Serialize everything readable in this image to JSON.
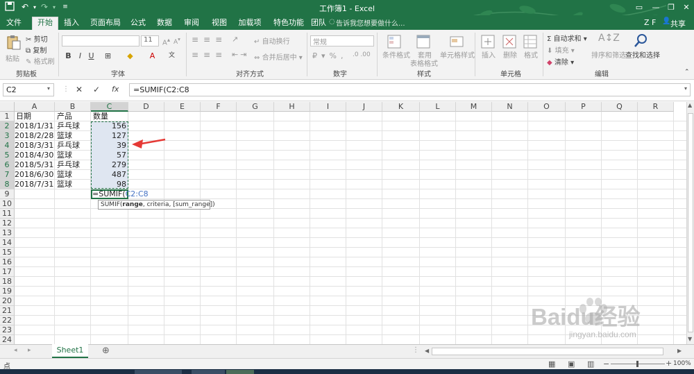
{
  "window": {
    "title": "工作簿1 - Excel",
    "user": "Z F",
    "share": "共享"
  },
  "tabs": [
    "文件",
    "开始",
    "插入",
    "页面布局",
    "公式",
    "数据",
    "审阅",
    "视图",
    "加载项",
    "特色功能",
    "团队"
  ],
  "active_tab": "开始",
  "tell_me": "告诉我您想要做什么...",
  "ribbon": {
    "clipboard": {
      "paste": "粘贴",
      "cut": "剪切",
      "copy": "复制",
      "format_painter": "格式刷",
      "group": "剪贴板"
    },
    "font": {
      "size": "11",
      "group": "字体"
    },
    "alignment": {
      "wrap": "自动换行",
      "merge": "合并后居中",
      "group": "对齐方式"
    },
    "number": {
      "format": "常规",
      "group": "数字"
    },
    "styles": {
      "conditional": "条件格式",
      "table_line1": "套用",
      "table_line2": "表格格式",
      "cell_styles": "单元格样式",
      "group": "样式"
    },
    "cells": {
      "insert": "插入",
      "delete": "删除",
      "format": "格式",
      "group": "单元格"
    },
    "editing": {
      "autosum": "自动求和",
      "fill": "填充",
      "clear": "清除",
      "sort": "排序和筛选",
      "find": "查找和选择",
      "group": "编辑"
    }
  },
  "formula_bar": {
    "name_box": "C2",
    "formula": "=SUMIF(C2:C8",
    "fx": "fx"
  },
  "columns": [
    "A",
    "B",
    "C",
    "D",
    "E",
    "F",
    "G",
    "H",
    "I",
    "J",
    "K",
    "L",
    "M",
    "N",
    "O",
    "P",
    "Q",
    "R"
  ],
  "rows": [
    "1",
    "2",
    "3",
    "4",
    "5",
    "6",
    "7",
    "8",
    "9",
    "10",
    "11",
    "12",
    "13",
    "14",
    "15",
    "16",
    "17",
    "18",
    "19",
    "20",
    "21",
    "22",
    "23",
    "24"
  ],
  "headers": {
    "a1": "日期",
    "b1": "产品",
    "c1": "数量"
  },
  "data_rows": [
    {
      "date": "2018/1/31",
      "product": "乒乓球",
      "qty": "156"
    },
    {
      "date": "2018/2/28",
      "product": "篮球",
      "qty": "127"
    },
    {
      "date": "2018/3/31",
      "product": "乒乓球",
      "qty": "39"
    },
    {
      "date": "2018/4/30",
      "product": "篮球",
      "qty": "57"
    },
    {
      "date": "2018/5/31",
      "product": "乒乓球",
      "qty": "279"
    },
    {
      "date": "2018/6/30",
      "product": "篮球",
      "qty": "487"
    },
    {
      "date": "2018/7/31",
      "product": "篮球",
      "qty": "98"
    }
  ],
  "editing_cell": {
    "prefix": "=SUMIF(",
    "ref": "C2:C8"
  },
  "tooltip": {
    "fn": "SUMIF(",
    "arg1": "range",
    "rest": ", criteria, [sum_range])"
  },
  "sheet_tab": "Sheet1",
  "status": {
    "mode": "点",
    "zoom": "100%"
  },
  "watermark": {
    "brand": "Baidu经验",
    "url": "jingyan.baidu.com"
  },
  "colors": {
    "excel_green": "#217346",
    "arrow_red": "#e53935",
    "selection_fill": "#dfe6f1"
  }
}
